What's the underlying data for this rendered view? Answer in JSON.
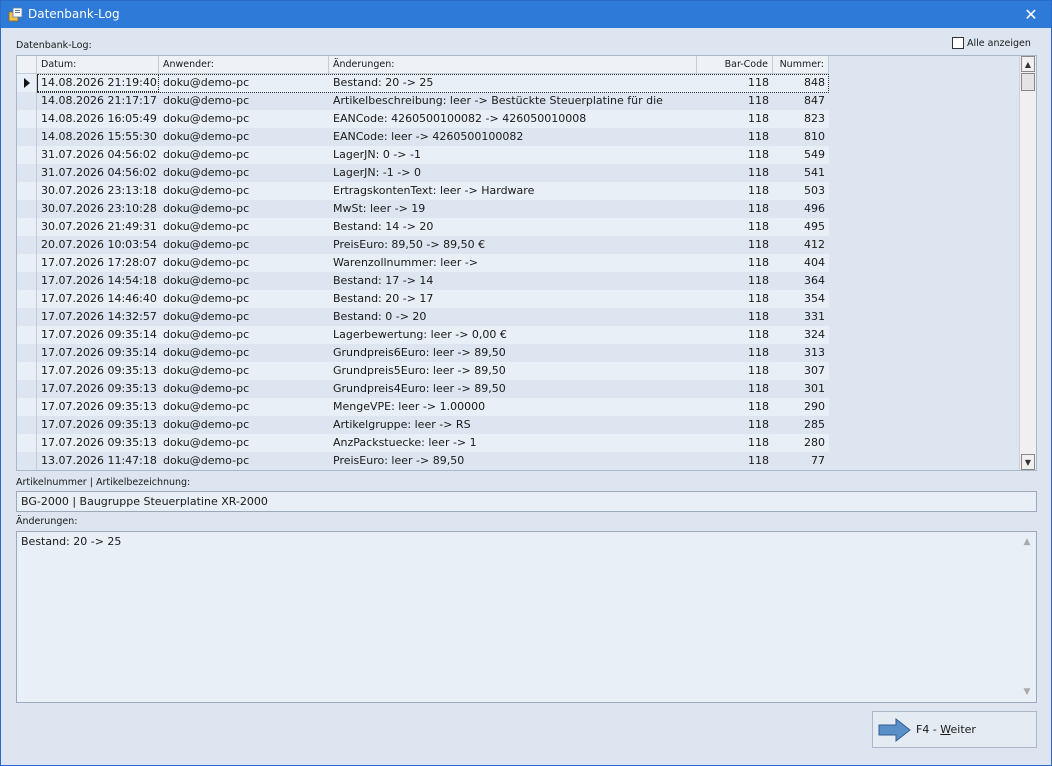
{
  "window": {
    "title": "Datenbank-Log",
    "close_glyph": "✕"
  },
  "log_label": "Datenbank-Log:",
  "show_all": {
    "label": "Alle anzeigen",
    "checked": false
  },
  "table": {
    "columns": [
      "Datum:",
      "Anwender:",
      "Änderungen:",
      "Bar-Code",
      "Nummer:"
    ],
    "rows": [
      [
        "14.08.2026 21:19:40",
        "doku@demo-pc",
        "Bestand: 20 -> 25",
        "118",
        "848"
      ],
      [
        "14.08.2026 21:17:17",
        "doku@demo-pc",
        "Artikelbeschreibung: leer -> Bestückte Steuerplatine für die",
        "118",
        "847"
      ],
      [
        "14.08.2026 16:05:49",
        "doku@demo-pc",
        "EANCode: 4260500100082 -> 426050010008",
        "118",
        "823"
      ],
      [
        "14.08.2026 15:55:30",
        "doku@demo-pc",
        "EANCode: leer -> 4260500100082",
        "118",
        "810"
      ],
      [
        "31.07.2026 04:56:02",
        "doku@demo-pc",
        "LagerJN: 0 -> -1",
        "118",
        "549"
      ],
      [
        "31.07.2026 04:56:02",
        "doku@demo-pc",
        "LagerJN: -1 -> 0",
        "118",
        "541"
      ],
      [
        "30.07.2026 23:13:18",
        "doku@demo-pc",
        "ErtragskontenText: leer -> Hardware",
        "118",
        "503"
      ],
      [
        "30.07.2026 23:10:28",
        "doku@demo-pc",
        "MwSt: leer -> 19",
        "118",
        "496"
      ],
      [
        "30.07.2026 21:49:31",
        "doku@demo-pc",
        "Bestand: 14 -> 20",
        "118",
        "495"
      ],
      [
        "20.07.2026 10:03:54",
        "doku@demo-pc",
        "PreisEuro: 89,50 -> 89,50 €",
        "118",
        "412"
      ],
      [
        "17.07.2026 17:28:07",
        "doku@demo-pc",
        "Warenzollnummer: leer ->",
        "118",
        "404"
      ],
      [
        "17.07.2026 14:54:18",
        "doku@demo-pc",
        "Bestand: 17 -> 14",
        "118",
        "364"
      ],
      [
        "17.07.2026 14:46:40",
        "doku@demo-pc",
        "Bestand: 20 -> 17",
        "118",
        "354"
      ],
      [
        "17.07.2026 14:32:57",
        "doku@demo-pc",
        "Bestand: 0 -> 20",
        "118",
        "331"
      ],
      [
        "17.07.2026 09:35:14",
        "doku@demo-pc",
        "Lagerbewertung: leer -> 0,00 €",
        "118",
        "324"
      ],
      [
        "17.07.2026 09:35:14",
        "doku@demo-pc",
        "Grundpreis6Euro: leer -> 89,50",
        "118",
        "313"
      ],
      [
        "17.07.2026 09:35:13",
        "doku@demo-pc",
        "Grundpreis5Euro: leer -> 89,50",
        "118",
        "307"
      ],
      [
        "17.07.2026 09:35:13",
        "doku@demo-pc",
        "Grundpreis4Euro: leer -> 89,50",
        "118",
        "301"
      ],
      [
        "17.07.2026 09:35:13",
        "doku@demo-pc",
        "MengeVPE: leer -> 1.00000",
        "118",
        "290"
      ],
      [
        "17.07.2026 09:35:13",
        "doku@demo-pc",
        "Artikelgruppe: leer -> RS",
        "118",
        "285"
      ],
      [
        "17.07.2026 09:35:13",
        "doku@demo-pc",
        "AnzPackstuecke: leer -> 1",
        "118",
        "280"
      ],
      [
        "13.07.2026 11:47:18",
        "doku@demo-pc",
        "PreisEuro: leer -> 89,50",
        "118",
        "77"
      ]
    ]
  },
  "article": {
    "label": "Artikelnummer | Artikelbezeichnung:",
    "value": "BG-2000 | Baugruppe Steuerplatine XR-2000"
  },
  "changes": {
    "label": "Änderungen:",
    "value": "Bestand: 20 -> 25"
  },
  "next_button": {
    "prefix": "F4 - ",
    "accel": "W",
    "rest": "eiter"
  }
}
